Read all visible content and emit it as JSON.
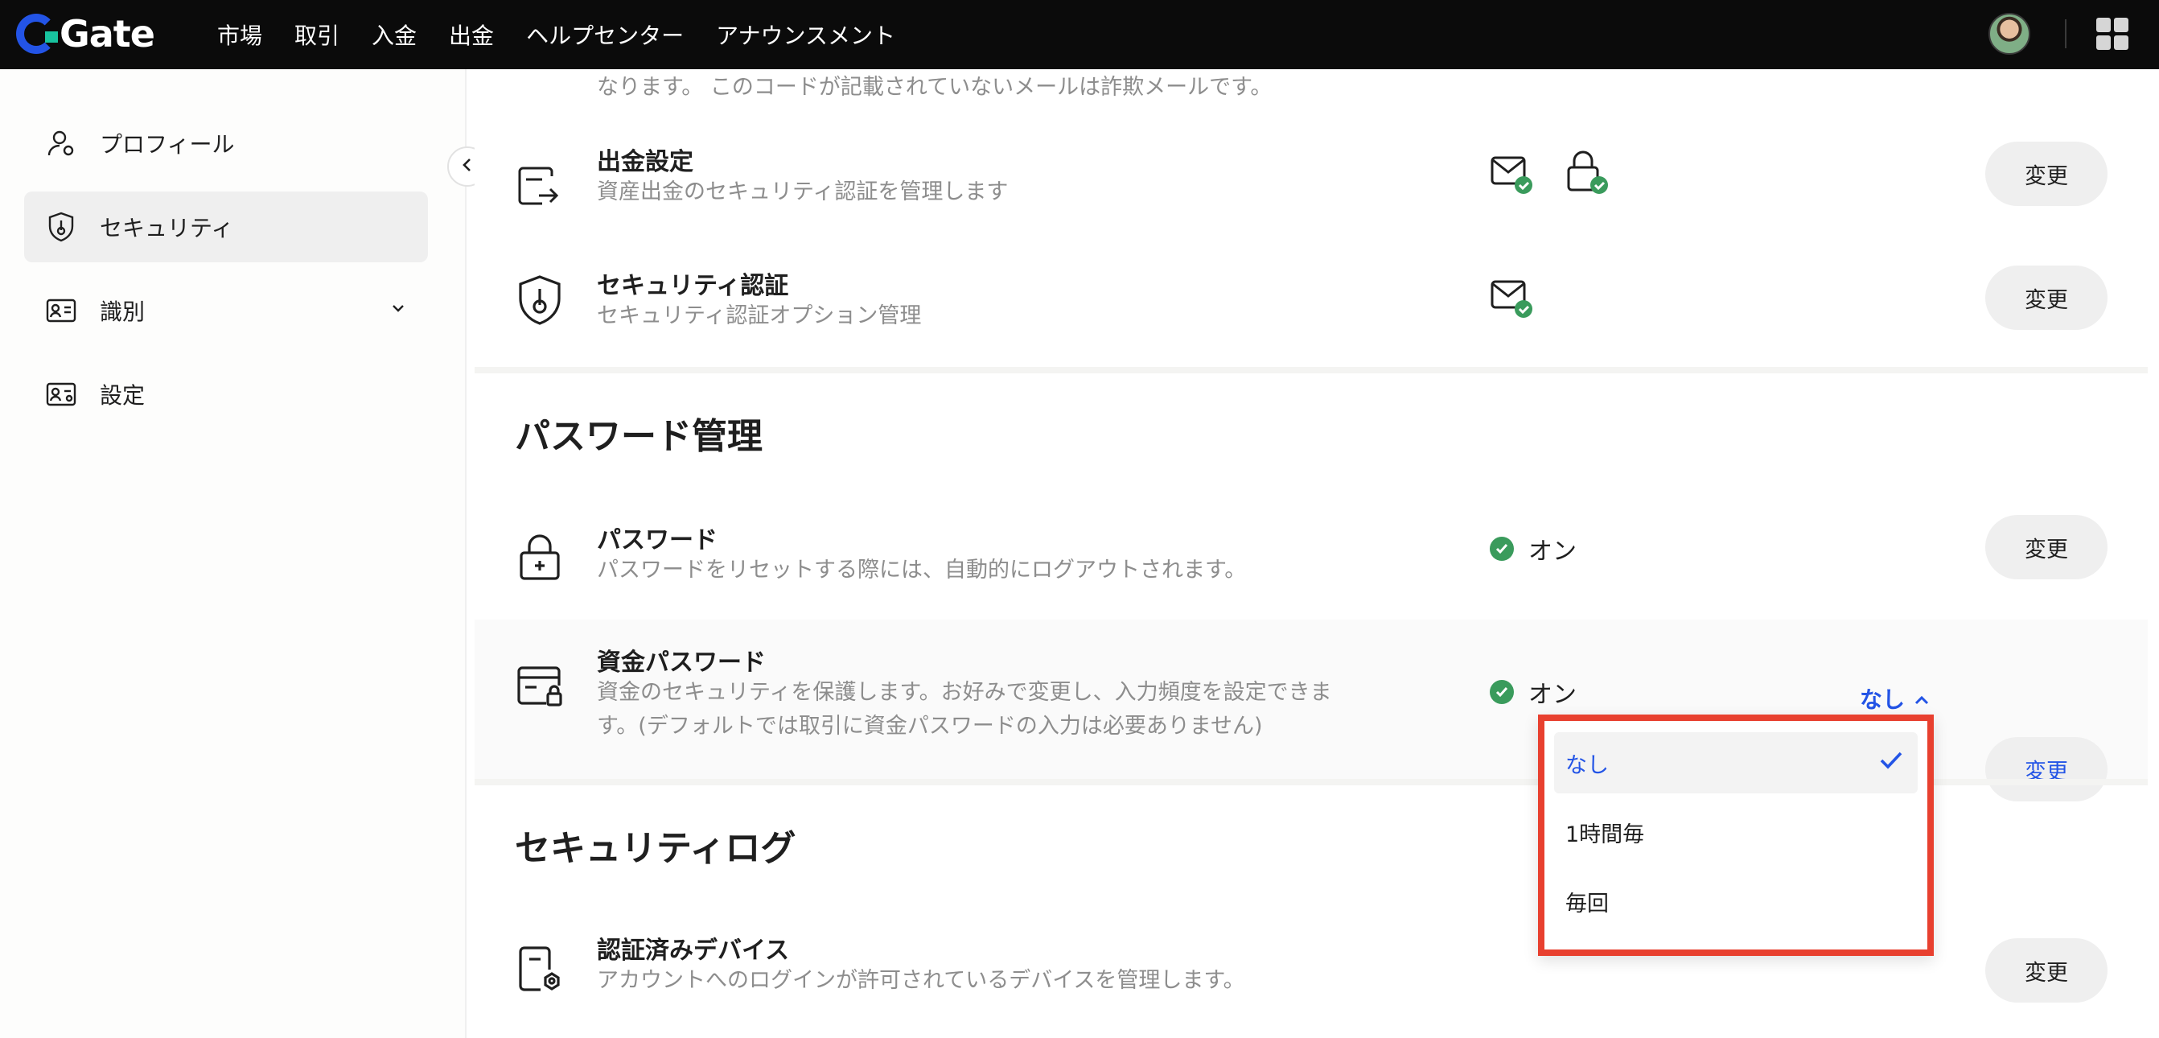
{
  "header": {
    "logo_text": "Gate",
    "nav": [
      "市場",
      "取引",
      "入金",
      "出金",
      "ヘルプセンター",
      "アナウンスメント"
    ]
  },
  "sidebar": {
    "items": [
      {
        "label": "プロフィール",
        "icon": "user-icon"
      },
      {
        "label": "セキュリティ",
        "icon": "shield-icon",
        "active": true
      },
      {
        "label": "識別",
        "icon": "id-card-icon",
        "expandable": true
      },
      {
        "label": "設定",
        "icon": "settings-card-icon"
      }
    ]
  },
  "main": {
    "top_note": "なります。 このコードが記載されていないメールは詐欺メールです。",
    "withdraw": {
      "title": "出金設定",
      "desc": "資産出金のセキュリティ認証を管理します",
      "button": "変更"
    },
    "security_auth": {
      "title": "セキュリティ認証",
      "desc": "セキュリティ認証オプション管理",
      "button": "変更"
    },
    "password_section": {
      "title": "パスワード管理"
    },
    "password": {
      "title": "パスワード",
      "desc": "パスワードをリセットする際には、自動的にログアウトされます。",
      "status": "オン",
      "button": "変更"
    },
    "fund_password": {
      "title": "資金パスワード",
      "desc_line1": "資金のセキュリティを保護します。お好みで変更し、入力頻度を設定できま",
      "desc_line2": "す。(デフォルトでは取引に資金パスワードの入力は必要ありません)",
      "status": "オン",
      "frequency": "なし",
      "button": "変更"
    },
    "security_log": {
      "title": "セキュリティログ"
    },
    "devices": {
      "title": "認証済みデバイス",
      "desc": "アカウントへのログインが許可されているデバイスを管理します。",
      "button": "変更"
    }
  },
  "dropdown": {
    "options": [
      "なし",
      "1時間毎",
      "毎回"
    ],
    "selected": "なし"
  },
  "colors": {
    "accent": "#2354e6",
    "success": "#3a9b5c",
    "highlight_border": "#e8402f"
  }
}
